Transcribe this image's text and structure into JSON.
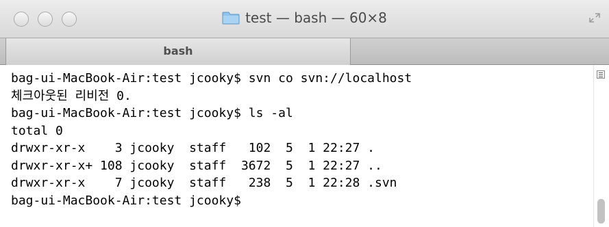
{
  "window": {
    "title": "test — bash — 60×8"
  },
  "tabs": [
    {
      "label": "bash"
    }
  ],
  "terminal": {
    "lines": [
      "bag-ui-MacBook-Air:test jcooky$ svn co svn://localhost",
      "체크아웃된 리비전 0.",
      "bag-ui-MacBook-Air:test jcooky$ ls -al",
      "total 0",
      "drwxr-xr-x    3 jcooky  staff   102  5  1 22:27 .",
      "drwxr-xr-x+ 108 jcooky  staff  3672  5  1 22:27 ..",
      "drwxr-xr-x    7 jcooky  staff   238  5  1 22:28 .svn",
      "bag-ui-MacBook-Air:test jcooky$"
    ]
  },
  "icons": {
    "close": "close-button-icon",
    "minimize": "minimize-button-icon",
    "zoom": "zoom-button-icon",
    "folder": "folder-icon",
    "fullscreen": "fullscreen-icon",
    "scroll_menu": "scroll-menu-icon"
  }
}
